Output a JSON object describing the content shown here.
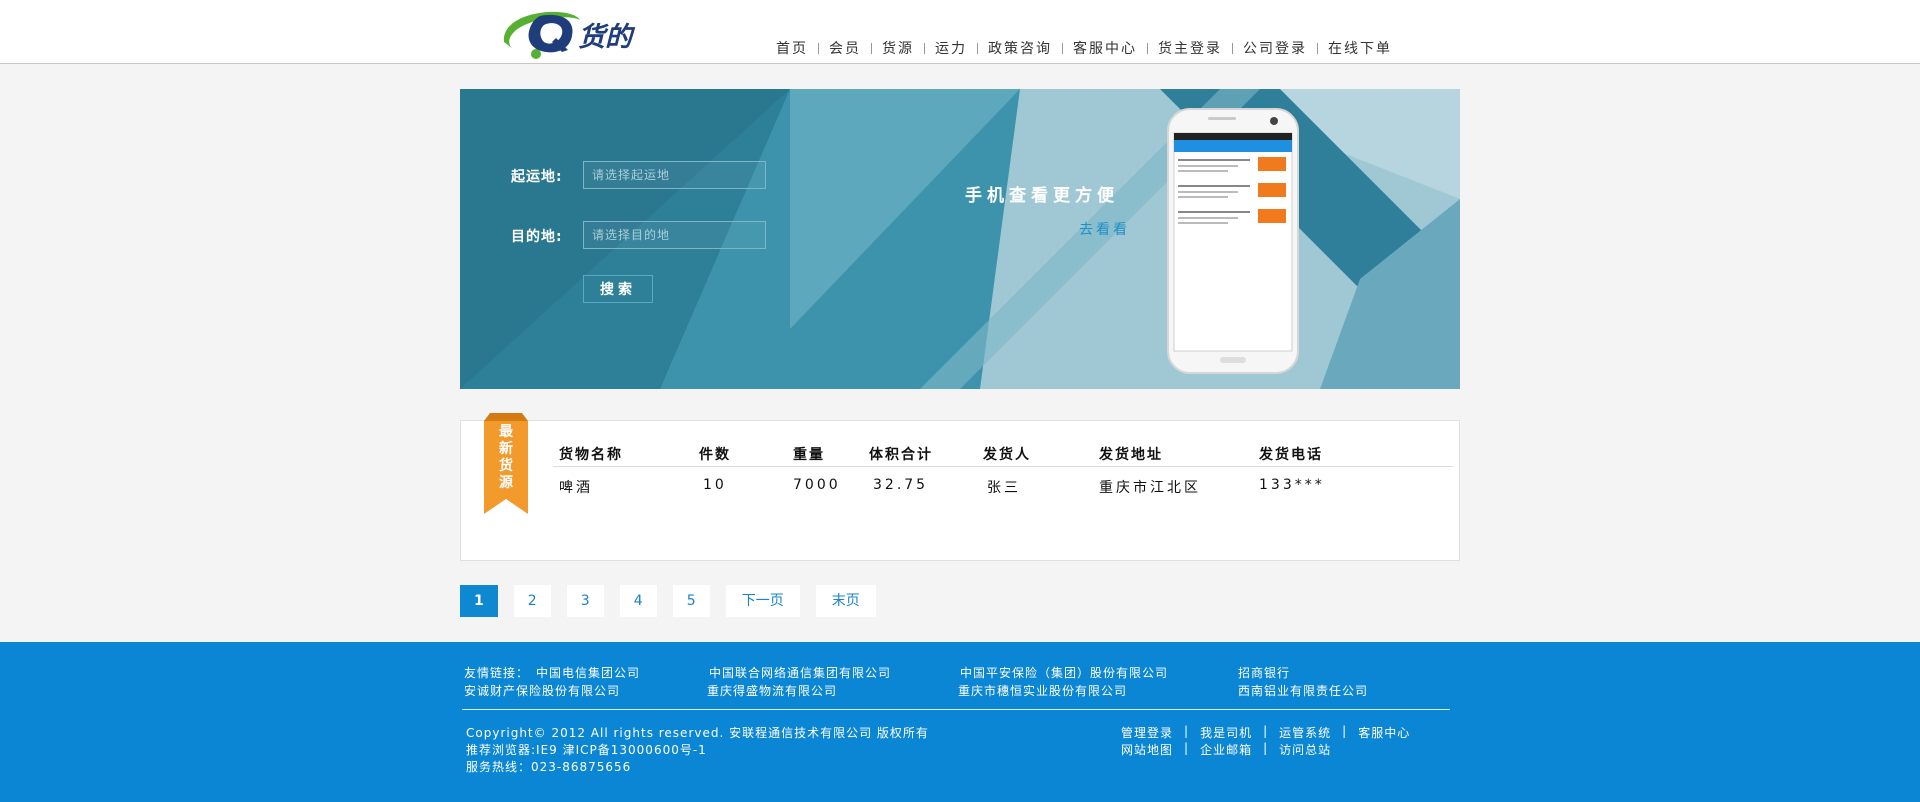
{
  "header": {
    "logo_text": "Q货的",
    "nav": [
      {
        "label": "首页"
      },
      {
        "label": "会员"
      },
      {
        "label": "货源"
      },
      {
        "label": "运力"
      },
      {
        "label": "政策咨询"
      },
      {
        "label": "客服中心"
      },
      {
        "label": "货主登录"
      },
      {
        "label": "公司登录"
      },
      {
        "label": "在线下单"
      }
    ]
  },
  "search": {
    "origin_label": "起运地:",
    "origin_placeholder": "请选择起运地",
    "destination_label": "目的地:",
    "destination_placeholder": "请选择目的地",
    "button_label": "搜索"
  },
  "promo": {
    "title": "手机查看更方便",
    "link": "去看看"
  },
  "cargo": {
    "ribbon": [
      "最",
      "新",
      "货",
      "源"
    ],
    "headers": [
      "货物名称",
      "件数",
      "重量",
      "体积合计",
      "发货人",
      "发货地址",
      "发货电话"
    ],
    "rows": [
      [
        "啤酒",
        "10",
        "7000",
        "32.75",
        "张三",
        "重庆市江北区",
        "133***"
      ]
    ]
  },
  "pager": {
    "pages": [
      "1",
      "2",
      "3",
      "4",
      "5"
    ],
    "active": "1",
    "next": "下一页",
    "last": "末页"
  },
  "footer": {
    "links_label": "友情链接：",
    "links": [
      "中国电信集团公司",
      "中国联合网络通信集团有限公司",
      "中国平安保险（集团）股份有限公司",
      "招商银行",
      "安诚财产保险股份有限公司",
      "重庆得盛物流有限公司",
      "重庆市穗恒实业股份有限公司",
      "西南铝业有限责任公司"
    ],
    "copyright": "Copyright© 2012 All rights reserved. 安联程通信技术有限公司 版权所有",
    "browser": "推荐浏览器:IE9  津ICP备13000600号-1",
    "hotline": "服务热线：023-86875656",
    "nav_row1": [
      "管理登录",
      "我是司机",
      "运管系统",
      "客服中心"
    ],
    "nav_row2": [
      "网站地图",
      "企业邮箱",
      "访问总站"
    ]
  },
  "colors": {
    "accent": "#0f88d2",
    "footer_bg": "#0a86d5",
    "ribbon": "#f39a2c",
    "banner_dark": "#2c7d95"
  }
}
